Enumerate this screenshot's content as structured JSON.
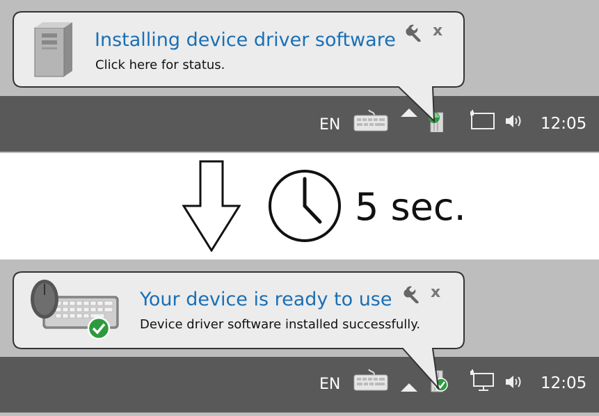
{
  "notification_before": {
    "title": "Installing device driver software",
    "subtitle": "Click here for status.",
    "icon": "computer-tower-icon",
    "settings_icon": "wrench-icon",
    "close_symbol": "x"
  },
  "transition": {
    "arrow_icon": "down-arrow-icon",
    "clock_icon": "clock-icon",
    "delay_label": "5 sec."
  },
  "notification_after": {
    "title": "Your device is ready to use",
    "subtitle": "Device driver software installed successfully.",
    "icon": "mouse-keyboard-check-icon",
    "settings_icon": "wrench-icon",
    "close_symbol": "x"
  },
  "taskbar": {
    "language": "EN",
    "time": "12:05",
    "tray_icons": [
      "keyboard-icon",
      "show-hidden-arrow-icon",
      "device-install-icon",
      "network-icon",
      "volume-icon"
    ]
  },
  "colors": {
    "title_blue": "#1a6fb5",
    "taskbar": "#595959",
    "desktop": "#bdbdbd",
    "balloon": "#ececec",
    "success_green": "#2e9a3f"
  }
}
